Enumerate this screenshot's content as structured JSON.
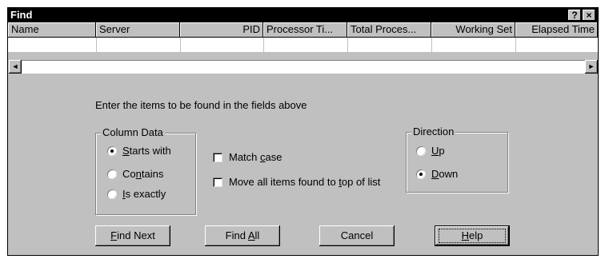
{
  "window": {
    "title": "Find",
    "help_btn": "?",
    "close_btn": "×"
  },
  "columns": [
    {
      "label": "Name"
    },
    {
      "label": "Server"
    },
    {
      "label": "PID"
    },
    {
      "label": "Processor Ti..."
    },
    {
      "label": "Total Proces..."
    },
    {
      "label": "Working Set"
    },
    {
      "label": "Elapsed Time"
    }
  ],
  "scroll": {
    "left_arrow": "◄",
    "right_arrow": "►"
  },
  "instructions": "Enter the items to be found in the fields above",
  "column_data": {
    "title": "Column Data",
    "options": [
      {
        "pre": "",
        "key": "S",
        "post": "tarts with",
        "selected": true
      },
      {
        "pre": "Co",
        "key": "n",
        "post": "tains",
        "selected": false
      },
      {
        "pre": "",
        "key": "I",
        "post": "s exactly",
        "selected": false
      }
    ]
  },
  "checkboxes": [
    {
      "pre": "Match ",
      "key": "c",
      "post": "ase",
      "checked": false
    },
    {
      "pre": "Move all items found to ",
      "key": "t",
      "post": "op of list",
      "checked": false
    }
  ],
  "direction": {
    "title": "Direction",
    "options": [
      {
        "pre": "",
        "key": "U",
        "post": "p",
        "selected": false
      },
      {
        "pre": "",
        "key": "D",
        "post": "own",
        "selected": true
      }
    ]
  },
  "buttons": {
    "find_next": {
      "pre": "",
      "key": "F",
      "post": "ind Next"
    },
    "find_all": {
      "pre": "Find ",
      "key": "A",
      "post": "ll"
    },
    "cancel": "Cancel",
    "help": {
      "pre": "",
      "key": "H",
      "post": "elp"
    }
  }
}
